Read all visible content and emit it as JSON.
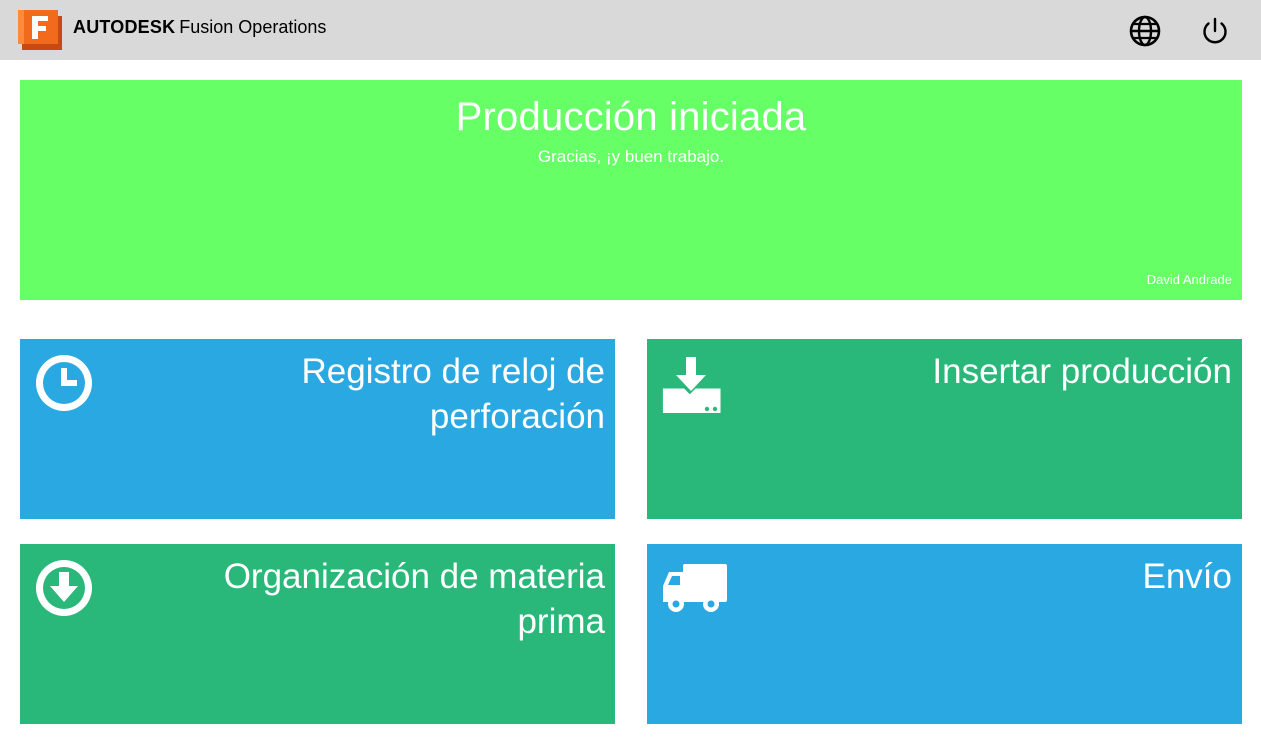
{
  "header": {
    "brand_bold": "AUTODESK",
    "brand_regular": "Fusion Operations",
    "logo_icon": "fusion-f-logo",
    "globe_icon": "globe-icon",
    "power_icon": "power-icon"
  },
  "banner": {
    "title": "Producción iniciada",
    "subtitle": "Gracias, ¡y buen trabajo.",
    "user": "David Andrade",
    "color": "#66ff66"
  },
  "tiles": [
    {
      "label": "Registro de reloj de perforación",
      "icon": "clock-icon",
      "color": "#29a8e2"
    },
    {
      "label": "Insertar producción",
      "icon": "download-tray-icon",
      "color": "#29b87a"
    },
    {
      "label": "Organización de materia prima",
      "icon": "arrow-down-circle-icon",
      "color": "#29b87a"
    },
    {
      "label": "Envío",
      "icon": "truck-icon",
      "color": "#29a8e2"
    }
  ],
  "colors": {
    "topbar": "#d9d9d9",
    "logo_orange": "#f26b1d",
    "blue": "#29a8e2",
    "green": "#29b87a"
  }
}
